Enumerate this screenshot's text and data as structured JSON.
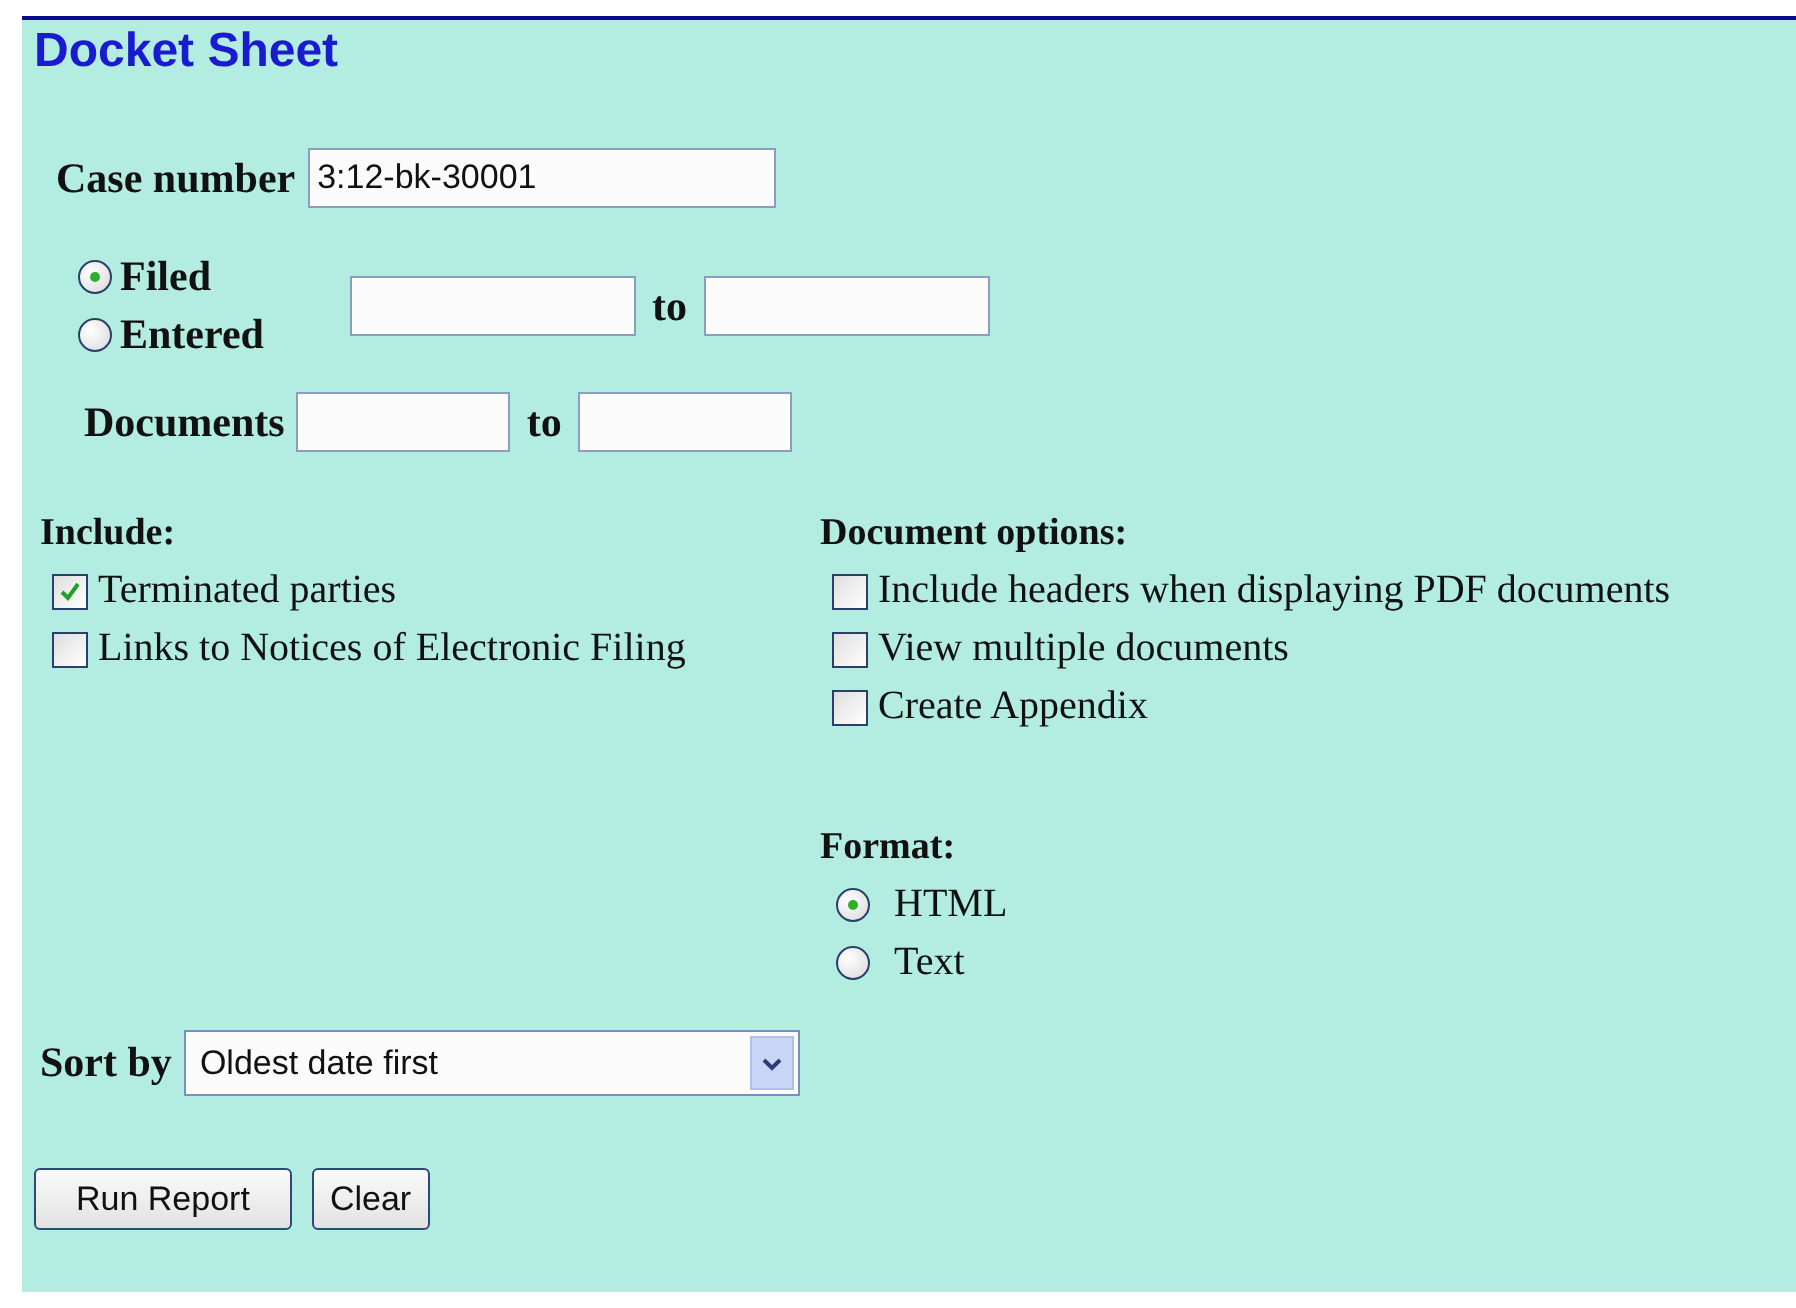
{
  "title": "Docket Sheet",
  "case_number": {
    "label": "Case number",
    "value": "3:12-bk-30001"
  },
  "date_filter": {
    "options": [
      {
        "label": "Filed",
        "selected": true
      },
      {
        "label": "Entered",
        "selected": false
      }
    ],
    "separator": "to"
  },
  "documents": {
    "label": "Documents",
    "separator": "to"
  },
  "include": {
    "heading": "Include:",
    "items": [
      {
        "label": "Terminated parties",
        "checked": true
      },
      {
        "label": "Links to Notices of Electronic Filing",
        "checked": false
      }
    ]
  },
  "document_options": {
    "heading": "Document options:",
    "items": [
      {
        "label": "Include headers when displaying PDF documents",
        "checked": false
      },
      {
        "label": "View multiple documents",
        "checked": false
      },
      {
        "label": "Create Appendix",
        "checked": false
      }
    ]
  },
  "format": {
    "heading": "Format:",
    "options": [
      {
        "label": "HTML",
        "selected": true
      },
      {
        "label": "Text",
        "selected": false
      }
    ]
  },
  "sort_by": {
    "label": "Sort by",
    "value": "Oldest date first"
  },
  "buttons": [
    "Run Report",
    "Clear"
  ]
}
